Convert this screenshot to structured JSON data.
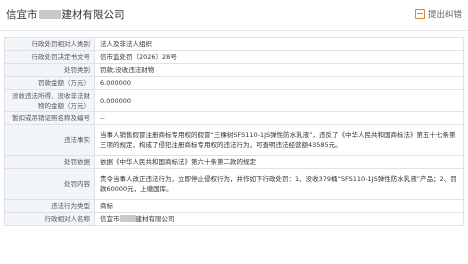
{
  "header": {
    "title_prefix": "信宜市",
    "title_suffix": "建材有限公司",
    "feedback_label": "提出纠错"
  },
  "rows": [
    {
      "key": "行政处罚相对人类别",
      "value": "法人及非法人组织"
    },
    {
      "key": "行政处罚决定书文号",
      "value": "信市监处罚〔2026〕28号"
    },
    {
      "key": "处罚类别",
      "value": "罚款;没收违法财物"
    },
    {
      "key": "罚款金额（万元）",
      "value": "6.000000"
    },
    {
      "key": "没收违法所得、没收非法财物的金额（万元）",
      "value": "0.000000"
    },
    {
      "key": "暂扣或吊销证照名称及编号",
      "value": "--"
    },
    {
      "key": "违法事实",
      "value": "当事人销售假冒注册商标专用权的假冒“三棵树SFS110-1JS弹性防水乳液”，违反了《中华人民共和国商标法》第五十七条第三项的规定，构成了侵犯注册商标专用权的违法行为，可查明违法经营额43585元。"
    },
    {
      "key": "处罚依据",
      "value": "依据《中华人民共和国商标法》第六十条第二款的规定"
    },
    {
      "key": "处罚内容",
      "value": "责令当事人改正违法行为，立即停止侵权行为，并作如下行政处罚：1、没收379桶“SFS110-1JS弹性防水乳液”产品；2、罚款60000元，上缴国库。"
    },
    {
      "key": "违法行为类型",
      "value": "商标"
    },
    {
      "key": "行政相对人名称",
      "value_prefix": "信宜市",
      "value_suffix": "建材有限公司"
    }
  ]
}
